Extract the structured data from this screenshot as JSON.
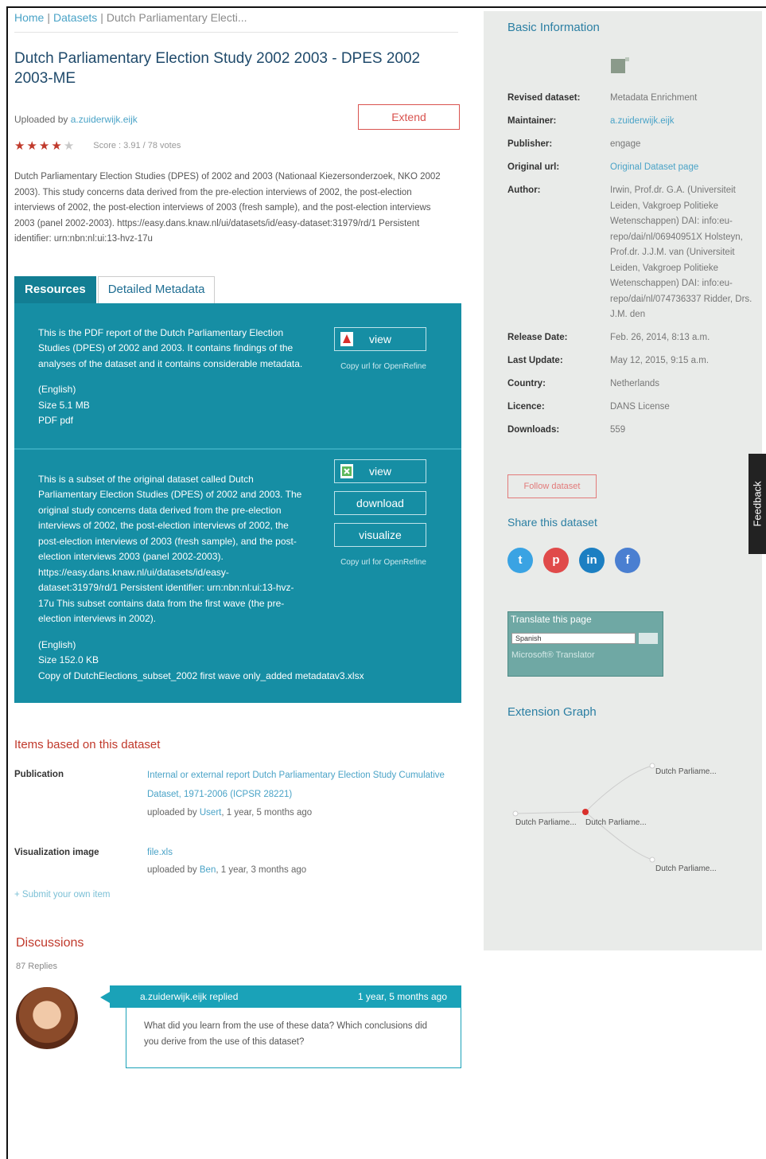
{
  "breadcrumb": {
    "home": "Home",
    "datasets": "Datasets",
    "current": "Dutch Parliamentary Electi..."
  },
  "title": "Dutch Parliamentary Election Study 2002 2003 - DPES 2002 2003-ME",
  "uploaded": {
    "prefix": "Uploaded by",
    "user": "a.zuiderwijk.eijk"
  },
  "extend_label": "Extend",
  "rating": {
    "stars_filled": 4,
    "stars_total": 5,
    "score_text": "Score : 3.91 / 78 votes"
  },
  "description": "Dutch Parliamentary Election Studies (DPES) of 2002 and 2003 (Nationaal Kiezersonderzoek, NKO 2002 2003). This study concerns data derived from the pre-election interviews of 2002, the post-election interviews of 2002, the post-election interviews of 2003 (fresh sample), and the post-election interviews 2003 (panel 2002-2003). https://easy.dans.knaw.nl/ui/datasets/id/easy-dataset:31979/rd/1 Persistent identifier: urn:nbn:nl:ui:13-hvz-17u",
  "tabs": {
    "resources": "Resources",
    "metadata": "Detailed Metadata"
  },
  "resources": [
    {
      "text": "This is the PDF report of the Dutch Parliamentary Election Studies (DPES) of 2002 and 2003. It contains findings of the analyses of the dataset and it contains considerable metadata.",
      "lang": "(English)",
      "size": "Size 5.1 MB",
      "format": "PDF pdf",
      "view": "view",
      "copy_url": "Copy url for OpenRefine"
    },
    {
      "text": "This is a subset of the original dataset called Dutch Parliamentary Election Studies (DPES) of 2002 and 2003. The original study concerns data derived from the pre-election interviews of 2002, the post-election interviews of 2002, the post-election interviews of 2003 (fresh sample), and the post-election interviews 2003 (panel 2002-2003). https://easy.dans.knaw.nl/ui/datasets/id/easy-dataset:31979/rd/1 Persistent identifier: urn:nbn:nl:ui:13-hvz-17u This subset contains data from the first wave (the pre-election interviews in 2002).",
      "lang": "(English)",
      "size": "Size 152.0 KB",
      "format": "Copy of DutchElections_subset_2002 first wave only_added metadatav3.xlsx",
      "view": "view",
      "download": "download",
      "visualize": "visualize",
      "copy_url": "Copy url for OpenRefine"
    }
  ],
  "items": {
    "title": "Items based on this dataset",
    "publication": {
      "label": "Publication",
      "link": "Internal or external report Dutch Parliamentary Election Study Cumulative Dataset, 1971-2006 (ICPSR 28221)",
      "by_prefix": "uploaded by",
      "user": "Usert",
      "ago": ", 1 year, 5 months ago"
    },
    "visualization": {
      "label": "Visualization image",
      "link": "file.xls",
      "by_prefix": "uploaded by",
      "user": "Ben",
      "ago": ", 1 year, 3 months ago"
    },
    "submit": "+ Submit your own item"
  },
  "discussions": {
    "title": "Discussions",
    "replies": "87 Replies",
    "comment": {
      "author": "a.zuiderwijk.eijk replied",
      "when": "1 year, 5 months ago",
      "text": "What did you learn from the use of these data? Which conclusions did you derive from the use of this dataset?"
    }
  },
  "basic": {
    "title": "Basic Information",
    "rows": [
      {
        "k": "Revised dataset:",
        "v": "Metadata Enrichment"
      },
      {
        "k": "Maintainer:",
        "v": "a.zuiderwijk.eijk"
      },
      {
        "k": "Publisher:",
        "v": "engage"
      },
      {
        "k": "Original url:",
        "v": "Original Dataset page"
      },
      {
        "k": "Author:",
        "v": "Irwin, Prof.dr. G.A. (Universiteit Leiden, Vakgroep Politieke Wetenschappen) DAI: info:eu-repo/dai/nl/06940951X Holsteyn, Prof.dr. J.J.M. van (Universiteit Leiden, Vakgroep Politieke Wetenschappen) DAI: info:eu-repo/dai/nl/074736337 Ridder, Drs. J.M. den"
      },
      {
        "k": "Release Date:",
        "v": "Feb. 26, 2014, 8:13 a.m."
      },
      {
        "k": "Last Update:",
        "v": "May 12, 2015, 9:15 a.m."
      },
      {
        "k": "Country:",
        "v": "Netherlands"
      },
      {
        "k": "Licence:",
        "v": "DANS License"
      },
      {
        "k": "Downloads:",
        "v": "559"
      }
    ]
  },
  "follow": "Follow dataset",
  "share_title": "Share this dataset",
  "social": [
    "twitter-icon",
    "pinterest-icon",
    "linkedin-icon",
    "facebook-icon"
  ],
  "translate": {
    "title": "Translate this page",
    "language": "Spanish",
    "brand": "Microsoft® Translator"
  },
  "graph": {
    "title": "Extension Graph",
    "nodes": [
      "Dutch Parliame...",
      "Dutch Parliame...",
      "Dutch Parliame...",
      "Dutch Parliame..."
    ]
  },
  "feedback": "Feedback"
}
